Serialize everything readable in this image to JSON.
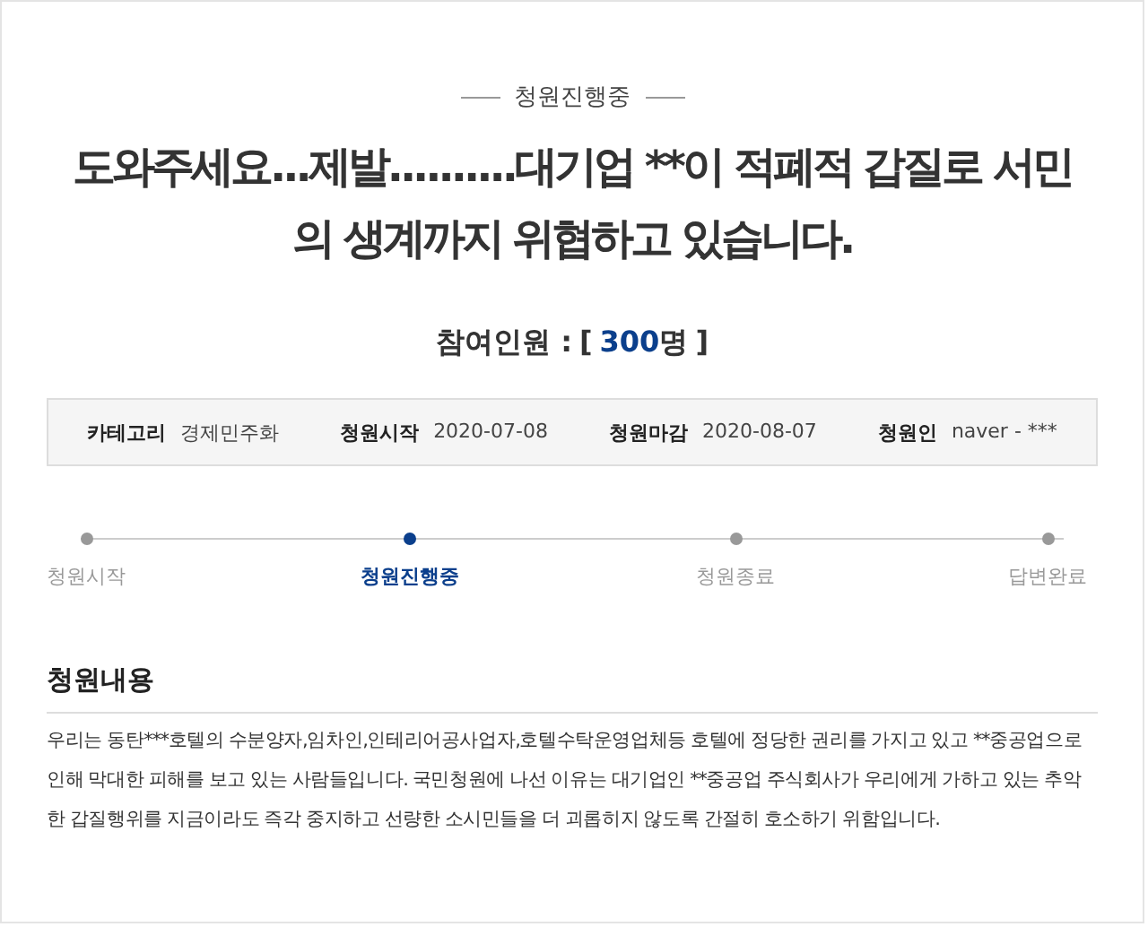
{
  "status_label": "청원진행중",
  "title": "도와주세요...제발..........대기업 **이 적폐적 갑질로 서민의 생계까지 위협하고 있습니다.",
  "participants": {
    "label": "참여인원 :",
    "open": "[",
    "count": "300",
    "unit": "명",
    "close": "]"
  },
  "info": [
    {
      "label": "카테고리",
      "value": "경제민주화"
    },
    {
      "label": "청원시작",
      "value": "2020-07-08"
    },
    {
      "label": "청원마감",
      "value": "2020-08-07"
    },
    {
      "label": "청원인",
      "value": "naver - ***"
    }
  ],
  "steps": [
    {
      "label": "청원시작",
      "selected": false
    },
    {
      "label": "청원진행중",
      "selected": true
    },
    {
      "label": "청원종료",
      "selected": false
    },
    {
      "label": "답변완료",
      "selected": false
    }
  ],
  "content": {
    "heading": "청원내용",
    "body": "우리는 동탄***호텔의 수분양자,임차인,인테리어공사업자,호텔수탁운영업체등 호텔에 정당한 권리를 가지고 있고 **중공업으로 인해 막대한 피해를 보고 있는 사람들입니다. 국민청원에 나선 이유는 대기업인 **중공업 주식회사가 우리에게 가하고 있는 추악한 갑질행위를 지금이라도 즉각 중지하고 선량한 소시민들을 더 괴롭히지 않도록 간절히 호소하기 위함입니다."
  }
}
